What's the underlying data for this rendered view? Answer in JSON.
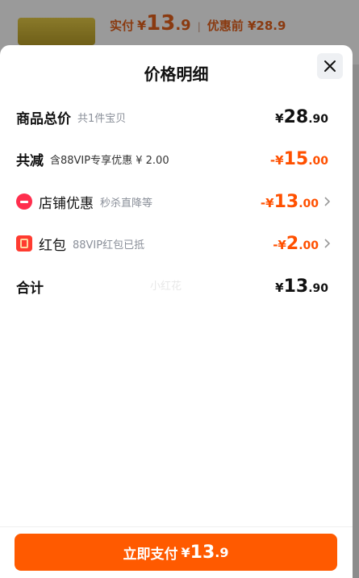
{
  "background": {
    "pay_label": "实付",
    "pay_yen": "¥",
    "pay_int": "13",
    "pay_dec": ".9",
    "separator": "|",
    "original_label": "优惠前 ¥28.9"
  },
  "sheet": {
    "title": "价格明细",
    "close_icon": "close-icon"
  },
  "rows": {
    "total": {
      "label": "商品总价",
      "sub": "共1件宝贝",
      "yen": "¥",
      "int": "28",
      "dec": ".90"
    },
    "discount": {
      "label": "共减",
      "sub": "含88VIP专享优惠 ¥ 2.00",
      "yen": "-¥",
      "int": "15",
      "dec": ".00"
    },
    "shop": {
      "icon": "shop-coupon-icon",
      "label": "店铺优惠",
      "sub": "秒杀直降等",
      "yen": "-¥",
      "int": "13",
      "dec": ".00"
    },
    "redpacket": {
      "icon": "red-packet-icon",
      "label": "红包",
      "sub": "88VIP红包已抵",
      "yen": "-¥",
      "int": "2",
      "dec": ".00"
    },
    "sum": {
      "label": "合计",
      "yen": "¥",
      "int": "13",
      "dec": ".90"
    }
  },
  "watermark": "小红花",
  "footer": {
    "pay_text": "立即支付",
    "yen": "¥",
    "int": "13",
    "dec": ".9"
  },
  "colors": {
    "accent": "#ff5000",
    "button": "#ff5a00",
    "shop_icon": "#ff2e4d",
    "red_packet": "#ff3b30"
  }
}
